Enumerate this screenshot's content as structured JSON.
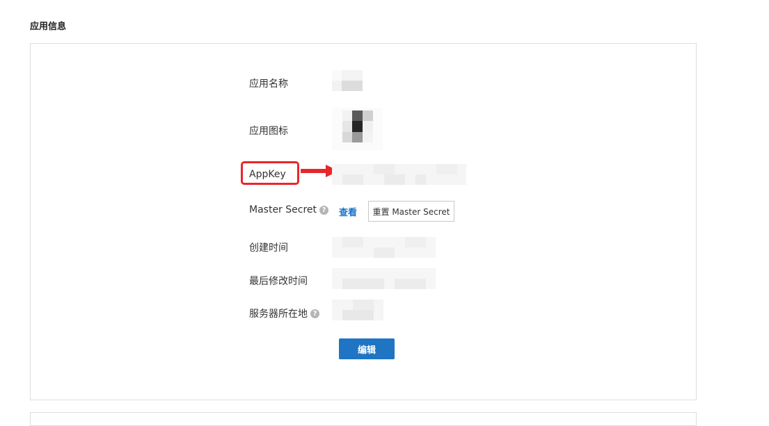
{
  "section": {
    "title": "应用信息"
  },
  "fields": {
    "app_name_label": "应用名称",
    "app_icon_label": "应用图标",
    "appkey_label": "AppKey",
    "master_secret_label": "Master Secret",
    "created_label": "创建时间",
    "modified_label": "最后修改时间",
    "server_location_label": "服务器所在地"
  },
  "help_glyph": "?",
  "actions": {
    "view_label": "查看",
    "reset_label": "重置 Master Secret",
    "edit_label": "编辑"
  },
  "colors": {
    "primary": "#1f75c4",
    "link": "#1a72c9",
    "annotation": "#e8262a"
  },
  "icons": {
    "help": "question-circle-icon",
    "annotation_arrow": "red-arrow-right"
  }
}
